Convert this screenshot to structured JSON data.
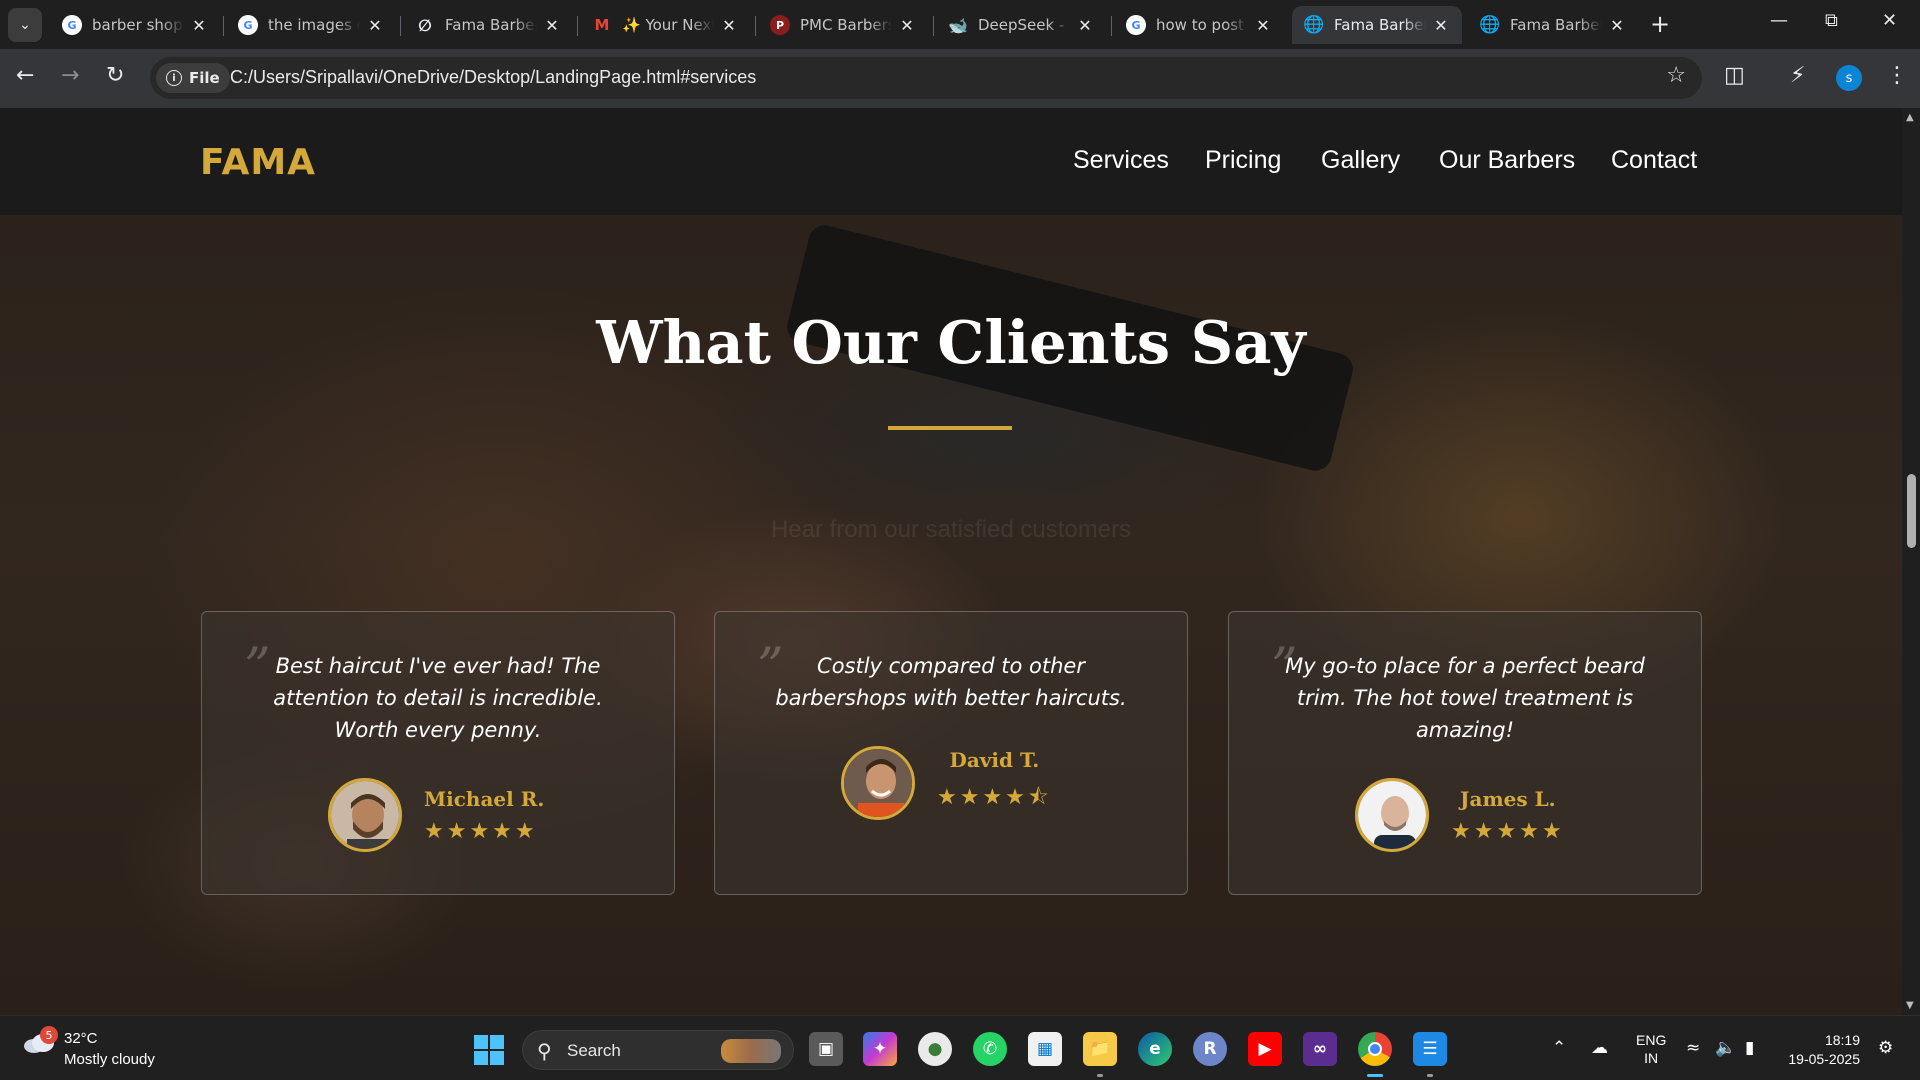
{
  "browser": {
    "tabs": [
      {
        "title": "barber shop p",
        "favicon": "google-icon"
      },
      {
        "title": "the images o",
        "favicon": "google-icon"
      },
      {
        "title": "Fama Barber S",
        "favicon": "perplexity-icon"
      },
      {
        "title": "✨ Your Next",
        "favicon": "gmail-icon"
      },
      {
        "title": "PMC Barbersh",
        "favicon": "pmc-icon"
      },
      {
        "title": "DeepSeek - In",
        "favicon": "deepseek-icon"
      },
      {
        "title": "how to post r",
        "favicon": "google-icon"
      },
      {
        "title": "Fama Barber",
        "favicon": "globe-icon",
        "active": true
      },
      {
        "title": "Fama Barber",
        "favicon": "globe-icon"
      }
    ],
    "chip_label": "File",
    "url": "C:/Users/Sripallavi/OneDrive/Desktop/LandingPage.html#services",
    "profile_initial": "s"
  },
  "site": {
    "logo": "FAMA",
    "nav": [
      "Services",
      "Pricing",
      "Gallery",
      "Our Barbers",
      "Contact"
    ],
    "section_title": "What Our Clients Say",
    "subtitle": "Hear from our satisfied customers",
    "testimonials": [
      {
        "quote": "Best haircut I've ever had! The attention to detail is incredible. Worth every penny.",
        "name": "Michael R.",
        "stars": "★★★★★",
        "rating": 5
      },
      {
        "quote": "Costly compared to other barbershops with better haircuts.",
        "name": "David T.",
        "stars": "★★★★⯪",
        "rating": 4.5
      },
      {
        "quote": "My go-to place for a perfect beard trim. The hot towel treatment is amazing!",
        "name": "James L.",
        "stars": "★★★★★",
        "rating": 5
      }
    ],
    "quote_mark": "”"
  },
  "taskbar": {
    "weather_badge": "5",
    "temperature": "32°C",
    "condition": "Mostly cloudy",
    "search_label": "Search",
    "lang_line1": "ENG",
    "lang_line2": "IN",
    "time": "18:19",
    "date": "19-05-2025"
  },
  "colors": {
    "accent": "#d4a93a",
    "nav_bg": "#1b1b1b",
    "windows_blue": "#4cc2ff"
  }
}
